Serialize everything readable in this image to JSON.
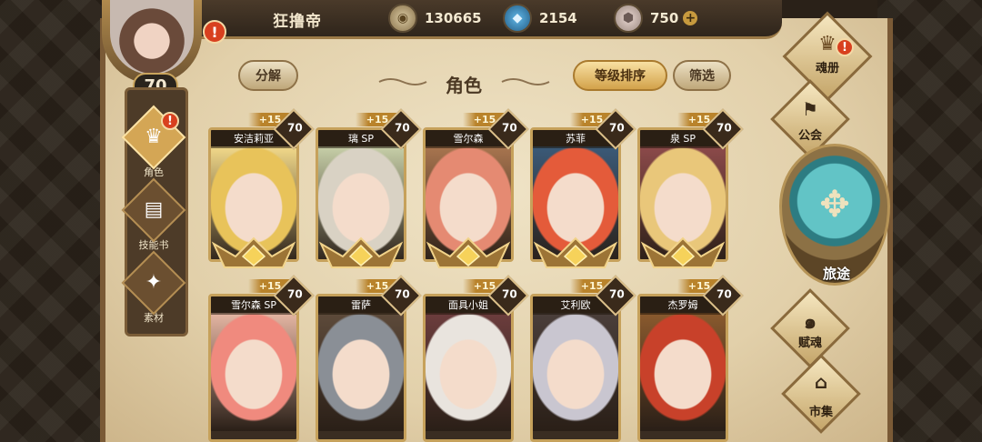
{
  "player": {
    "name": "狂撸帝",
    "level": "70"
  },
  "resources": [
    {
      "icon": "gold-coin-icon",
      "value": "130665"
    },
    {
      "icon": "blue-crystal-icon",
      "value": "2154"
    },
    {
      "icon": "stone-icon",
      "value": "750"
    }
  ],
  "header": {
    "title": "角色",
    "decompose_label": "分解",
    "sort_label": "等级排序",
    "filter_label": "筛选"
  },
  "left_nav": [
    {
      "label": "角色",
      "icon": "helmet-icon",
      "active": true,
      "alert": true
    },
    {
      "label": "技能书",
      "icon": "skill-book-icon",
      "active": false,
      "alert": false
    },
    {
      "label": "素材",
      "icon": "material-icon",
      "active": false,
      "alert": false
    }
  ],
  "right_nav": [
    {
      "label": "魂册",
      "icon": "soul-book-icon",
      "alert": true
    },
    {
      "label": "公会",
      "icon": "guild-icon",
      "alert": false
    },
    {
      "label": "旅途",
      "icon": "journey-compass-icon",
      "alert": false
    },
    {
      "label": "赋魂",
      "icon": "soul-swirl-icon",
      "alert": false
    },
    {
      "label": "市集",
      "icon": "market-icon",
      "alert": false
    }
  ],
  "characters": [
    {
      "name": "安洁莉亚",
      "bonus": "+15",
      "level": "70",
      "hair": "#e8c35a",
      "bg": "#f2d98a"
    },
    {
      "name": "璃 SP",
      "bonus": "+15",
      "level": "70",
      "hair": "#d9d2c4",
      "bg": "#c7cfa8"
    },
    {
      "name": "雪尔森",
      "bonus": "+15",
      "level": "70",
      "hair": "#e58a72",
      "bg": "#a8754f"
    },
    {
      "name": "苏菲",
      "bonus": "+15",
      "level": "70",
      "hair": "#e45b3a",
      "bg": "#3b5a78"
    },
    {
      "name": "泉 SP",
      "bonus": "+15",
      "level": "70",
      "hair": "#e9c77a",
      "bg": "#8c4a4a"
    },
    {
      "name": "雪尔森 SP",
      "bonus": "+15",
      "level": "70",
      "hair": "#f08a7e",
      "bg": "#e5b6a3"
    },
    {
      "name": "雷萨",
      "bonus": "+15",
      "level": "70",
      "hair": "#8a8f96",
      "bg": "#5d4a3a"
    },
    {
      "name": "面具小姐",
      "bonus": "+15",
      "level": "70",
      "hair": "#e9e4de",
      "bg": "#6c3d3d"
    },
    {
      "name": "艾利欧",
      "bonus": "+15",
      "level": "70",
      "hair": "#c9c6d0",
      "bg": "#4a3e3a"
    },
    {
      "name": "杰罗姆",
      "bonus": "+15",
      "level": "70",
      "hair": "#c8412a",
      "bg": "#8a5a2e"
    }
  ]
}
